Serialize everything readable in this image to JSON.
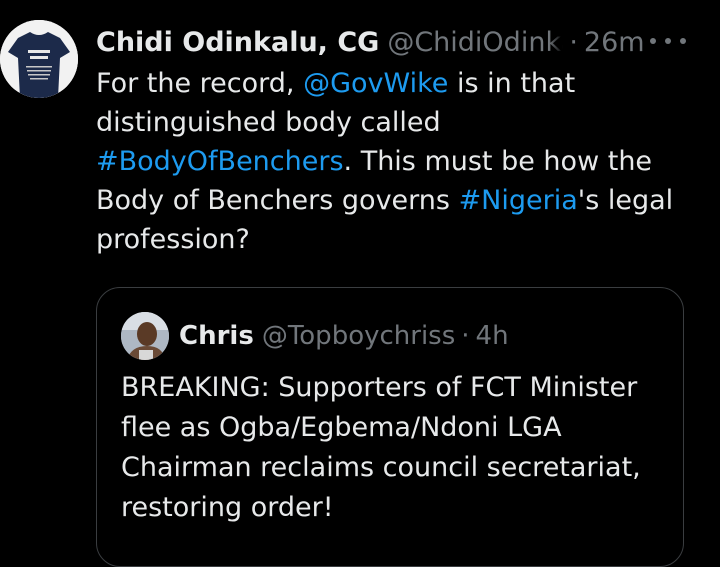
{
  "colors": {
    "background": "#000000",
    "text_primary": "#e7e9ea",
    "text_secondary": "#71767b",
    "link": "#1d9bf0",
    "quote_border": "#3a3d40"
  },
  "tweet": {
    "author_name": "Chidi Odinkalu, CG",
    "handle": "@ChidiOdinkalu",
    "separator": "·",
    "time": "26m",
    "more_icon": "more-horizontal-icon",
    "avatar_icon": "profile-photo-shirt",
    "lines": [
      [
        {
          "text": "For the record, "
        },
        {
          "text": "@GovWike",
          "link": true
        },
        {
          "text": " is in that"
        }
      ],
      [
        {
          "text": "distinguished body called"
        }
      ],
      [
        {
          "text": "#BodyOfBenchers",
          "link": true
        },
        {
          "text": ". This must be how the"
        }
      ],
      [
        {
          "text": "Body of Benchers governs "
        },
        {
          "text": "#Nigeria",
          "link": true
        },
        {
          "text": "'s legal"
        }
      ],
      [
        {
          "text": "profession?"
        }
      ]
    ]
  },
  "quote": {
    "author_name": "Chris",
    "handle": "@Topboychriss",
    "separator": "·",
    "time": "4h",
    "avatar_icon": "profile-photo-person",
    "lines": [
      "BREAKING: Supporters of FCT Minister",
      "flee as Ogba/Egbema/Ndoni LGA",
      "Chairman reclaims council secretariat,",
      "restoring order!"
    ]
  }
}
